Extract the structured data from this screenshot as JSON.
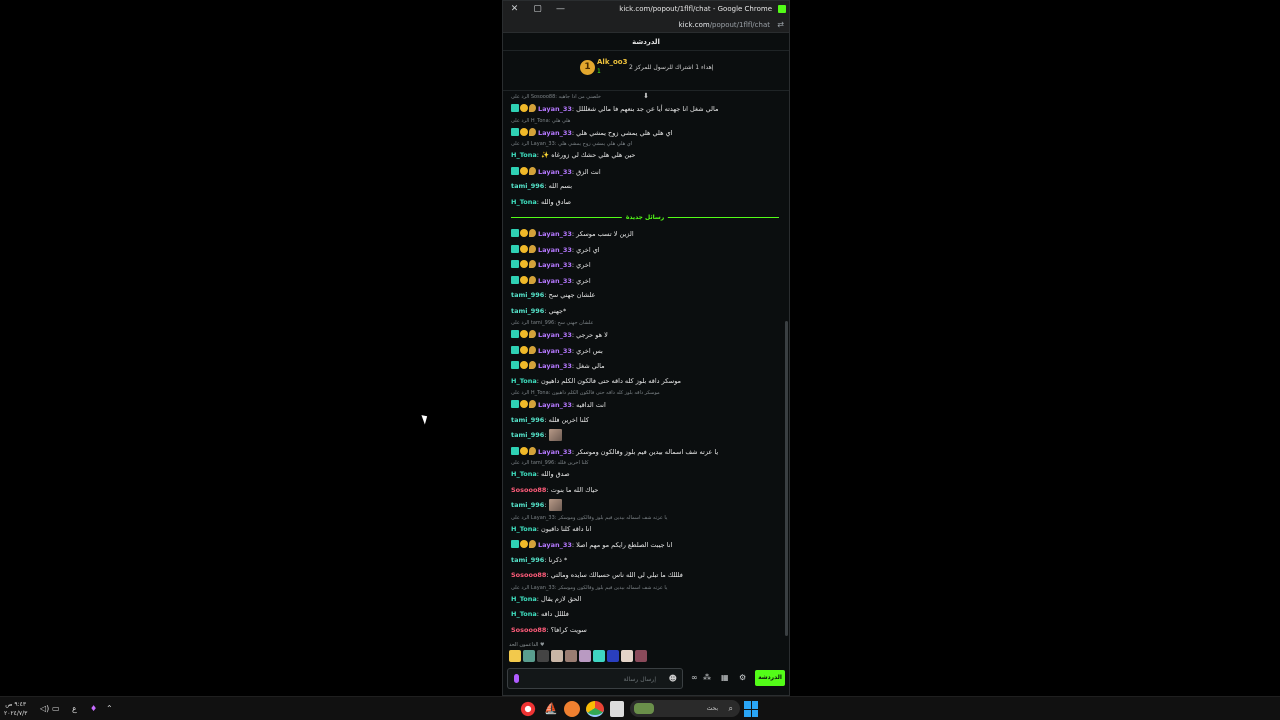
{
  "window": {
    "title": "kick.com/popout/1flfl/chat - Google Chrome",
    "url_domain": "kick.com",
    "url_path": "/popout/1flfl/chat",
    "close_glyph": "✕",
    "restore_glyph": "▢",
    "minimize_glyph": "—"
  },
  "chat": {
    "header": "الدردشة",
    "pinned": {
      "rank_number": "1",
      "username": "Alk_oo3",
      "rank_label": "1",
      "info": "إهداء 1 اشتراك للرسول للمركز 2"
    },
    "new_messages_label": "رسائل جديدة",
    "messages_before": [
      {
        "reply": "الرد على Sosooo88: خلصني من اذا جاهيه",
        "user": "Layan_33",
        "cls": "u-layan",
        "badges": true,
        "text": "مالي شغل انا جهدته أيا عن جد بنعهم فا مالي شغلللل"
      },
      {
        "reply": "الرد على H_Tona: هلي هلي",
        "user": "Layan_33",
        "cls": "u-layan",
        "badges": true,
        "text": "اي هلي هلي يمشي زوح يمشي هلي"
      },
      {
        "reply": "الرد على Layan_33: اي هلي هلي يمشي زوح يمشي هلي",
        "user": "H_Tona",
        "cls": "u-tona",
        "badges": false,
        "text": "✨ حين هلي هلي حشك لي زورغاه"
      },
      {
        "reply": "",
        "user": "Layan_33",
        "cls": "u-layan",
        "badges": true,
        "text": "انت الزق"
      },
      {
        "reply": "",
        "user": "tami_996",
        "cls": "u-tami",
        "badges": false,
        "text": "بسم الله"
      },
      {
        "reply": "",
        "user": "H_Tona",
        "cls": "u-tona",
        "badges": false,
        "text": "صادق والله"
      }
    ],
    "messages_after": [
      {
        "reply": "",
        "user": "Layan_33",
        "cls": "u-layan",
        "badges": true,
        "text": "الزين لا تسب موسكر"
      },
      {
        "reply": "",
        "user": "Layan_33",
        "cls": "u-layan",
        "badges": true,
        "text": "اي اخري"
      },
      {
        "reply": "",
        "user": "Layan_33",
        "cls": "u-layan",
        "badges": true,
        "text": "اخري"
      },
      {
        "reply": "",
        "user": "Layan_33",
        "cls": "u-layan",
        "badges": true,
        "text": "اخري"
      },
      {
        "reply": "",
        "user": "tami_996",
        "cls": "u-tami",
        "badges": false,
        "text": "علشان جهني سح"
      },
      {
        "reply": "",
        "user": "tami_996",
        "cls": "u-tami",
        "badges": false,
        "text": "جهني*"
      },
      {
        "reply": "الرد على tami_996: علشان جهني سح",
        "user": "Layan_33",
        "cls": "u-layan",
        "badges": true,
        "text": "لا هو حرجي"
      },
      {
        "reply": "",
        "user": "Layan_33",
        "cls": "u-layan",
        "badges": true,
        "text": "بس اخري"
      },
      {
        "reply": "",
        "user": "Layan_33",
        "cls": "u-layan",
        "badges": true,
        "text": "مالي شغل"
      },
      {
        "reply": "",
        "user": "H_Tona",
        "cls": "u-tona",
        "badges": false,
        "text": "موسكر داقه بلوز كله داقه حتى فالكون الكلم داهيون"
      },
      {
        "reply": "الرد على H_Tona: موسكر داقه بلوز كله داقه حتى فالكون الكلم داهيون",
        "user": "Layan_33",
        "cls": "u-layan",
        "badges": true,
        "text": "انت الداقيه"
      },
      {
        "reply": "",
        "user": "tami_996",
        "cls": "u-tami",
        "badges": false,
        "text": "كلنا اخرين فلله"
      },
      {
        "reply": "",
        "user": "tami_996",
        "cls": "u-tami",
        "badges": false,
        "text": "",
        "emote": true
      },
      {
        "reply": "",
        "user": "Layan_33",
        "cls": "u-layan",
        "badges": true,
        "text": "يا عزته شف اسماله بيدين فيم بلوز وفالكون وموسكر"
      },
      {
        "reply": "الرد على tami_996: كلنا اخرين فلله",
        "user": "H_Tona",
        "cls": "u-tona",
        "badges": false,
        "text": "صدق والله"
      },
      {
        "reply": "",
        "user": "Sosooo88",
        "cls": "u-sos",
        "badges": false,
        "text": "حياك الله ما بنوت"
      },
      {
        "reply": "",
        "user": "tami_996",
        "cls": "u-tami",
        "badges": false,
        "text": "",
        "emote": true
      },
      {
        "reply": "الرد على Layan_33: يا عزته شف اسماله بيدين فيم بلوز وفالكون وموسكر",
        "user": "H_Tona",
        "cls": "u-tona",
        "badges": false,
        "text": "انا داقه كلنا داقيون"
      },
      {
        "reply": "",
        "user": "Layan_33",
        "cls": "u-layan",
        "badges": true,
        "text": "انا جيبت الصلطع رايكم مو مهم اصلا"
      },
      {
        "reply": "",
        "user": "tami_996",
        "cls": "u-tami",
        "badges": false,
        "text": "ذكرنا *"
      },
      {
        "reply": "",
        "user": "Sosooo88",
        "cls": "u-sos",
        "badges": false,
        "text": "فلللك ما تبلي لي الله ناس حسبالك سايده ومالتي"
      },
      {
        "reply": "الرد على Layan_33: يا عزته شف اسماله بيدين فيم بلوز وفالكون وموسكر",
        "user": "H_Tona",
        "cls": "u-tona",
        "badges": false,
        "text": "الحق لازم يقال"
      },
      {
        "reply": "",
        "user": "H_Tona",
        "cls": "u-tona",
        "badges": false,
        "text": "فلللل داقه"
      },
      {
        "reply": "",
        "user": "Sosooo88",
        "cls": "u-sos",
        "badges": false,
        "text": "سويت كرافا؟"
      }
    ],
    "supporters_label": "الداعمون الحد ♥",
    "input_placeholder": "إرسال رسالة",
    "send_label": "الدردشة",
    "supporter_colors": [
      "#f2c94c",
      "#5a9e8f",
      "#444",
      "#c9b6a6",
      "#9a7d72",
      "#b99ac2",
      "#3fd5c2",
      "#2a3fbf",
      "#e4d4c8",
      "#8a4a5a"
    ]
  },
  "taskbar": {
    "time": "٩:٤٣ ص",
    "date": "٢٠٢٤/٧/٣",
    "lang": "ع",
    "search_label": "بحث"
  }
}
